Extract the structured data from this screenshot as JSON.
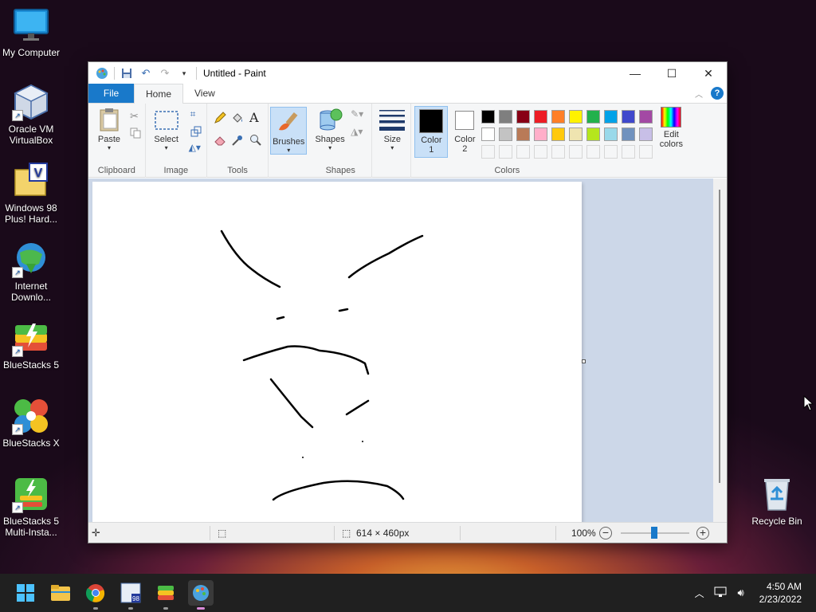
{
  "desktop": {
    "icons": [
      {
        "label_line1": "My Computer",
        "label_line2": ""
      },
      {
        "label_line1": "Oracle VM",
        "label_line2": "VirtualBox"
      },
      {
        "label_line1": "Windows 98",
        "label_line2": "Plus! Hard..."
      },
      {
        "label_line1": "Internet",
        "label_line2": "Downlo..."
      },
      {
        "label_line1": "BlueStacks 5",
        "label_line2": ""
      },
      {
        "label_line1": "BlueStacks X",
        "label_line2": ""
      },
      {
        "label_line1": "BlueStacks 5",
        "label_line2": "Multi-Insta..."
      },
      {
        "label_line1": "Recycle Bin",
        "label_line2": ""
      }
    ]
  },
  "window": {
    "title": "Untitled - Paint",
    "tabs": {
      "file": "File",
      "home": "Home",
      "view": "View"
    },
    "ribbon": {
      "clipboard": {
        "paste": "Paste",
        "group": "Clipboard"
      },
      "image": {
        "select": "Select",
        "group": "Image"
      },
      "tools": {
        "group": "Tools"
      },
      "brushes": {
        "label": "Brushes"
      },
      "shapes": {
        "label": "Shapes",
        "group": "Shapes"
      },
      "size": {
        "label": "Size"
      },
      "colors": {
        "color1_line1": "Color",
        "color1_line2": "1",
        "color2_line1": "Color",
        "color2_line2": "2",
        "edit_line1": "Edit",
        "edit_line2": "colors",
        "group": "Colors",
        "color1_value": "#000000",
        "color2_value": "#ffffff",
        "palette_row1": [
          "#000000",
          "#7f7f7f",
          "#880015",
          "#ed1c24",
          "#ff7f27",
          "#fff200",
          "#22b14c",
          "#00a2e8",
          "#3f48cc",
          "#a349a4"
        ],
        "palette_row2": [
          "#ffffff",
          "#c3c3c3",
          "#b97a57",
          "#ffaec9",
          "#ffc90e",
          "#efe4b0",
          "#b5e61d",
          "#99d9ea",
          "#7092be",
          "#c8bfe7"
        ]
      }
    },
    "status": {
      "dimensions": "614 × 460px",
      "zoom": "100%"
    }
  },
  "taskbar": {
    "time": "4:50 AM",
    "date": "2/23/2022"
  }
}
